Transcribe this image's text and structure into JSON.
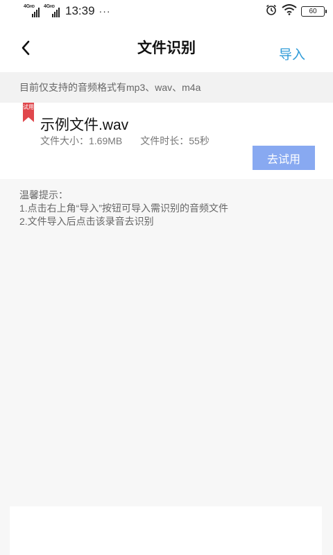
{
  "status_bar": {
    "sim1": "4G",
    "sim1_sup": "HD",
    "sim2": "4G",
    "sim2_sup": "HD",
    "time": "13:39",
    "dots": "···",
    "battery": "60"
  },
  "nav": {
    "title": "文件识别",
    "import_label": "导入"
  },
  "notice": {
    "text": "目前仅支持的音频格式有mp3、wav、m4a"
  },
  "file": {
    "badge": "试用",
    "name": "示例文件.wav",
    "size": "文件大小：1.69MB",
    "duration": "文件时长：55秒",
    "try_label": "去试用"
  },
  "tips": {
    "title": "温馨提示：",
    "line1": "1.点击右上角“导入”按钮可导入需识别的音频文件",
    "line2": "2.文件导入后点击该录音去识别"
  },
  "colors": {
    "accent": "#2f9bd8",
    "button": "#88a9f1",
    "badge": "#e0474c"
  }
}
